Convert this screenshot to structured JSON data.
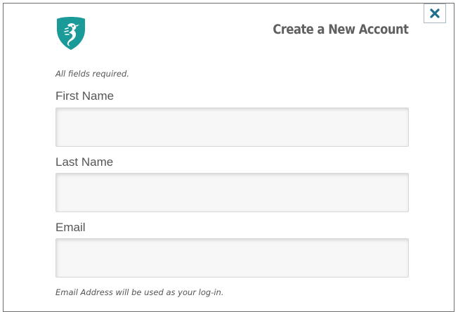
{
  "dialog": {
    "title": "Create a New Account",
    "close_icon": "close-x-icon",
    "logo_icon": "seahorse-shield-logo-icon"
  },
  "form": {
    "required_note": "All fields required.",
    "fields": [
      {
        "label": "First Name",
        "value": "",
        "placeholder": ""
      },
      {
        "label": "Last Name",
        "value": "",
        "placeholder": ""
      },
      {
        "label": "Email",
        "value": "",
        "placeholder": ""
      }
    ],
    "email_note": "Email Address will be used as your log-in."
  },
  "colors": {
    "brand_teal": "#1a9a98",
    "title_gray": "#5f5f5f",
    "close_blue": "#1f6f8b"
  }
}
